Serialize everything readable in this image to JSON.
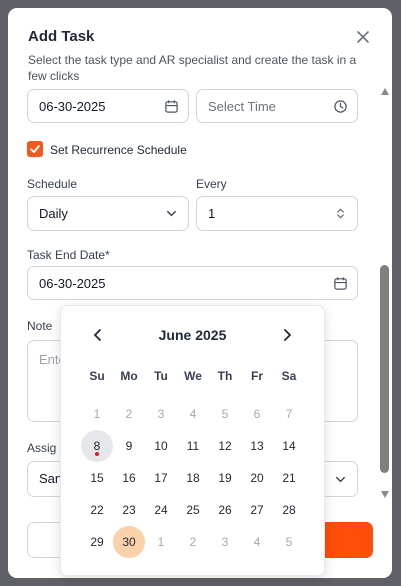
{
  "modal": {
    "title": "Add Task",
    "subtitle": "Select the task type and AR specialist and create the task in a few clicks"
  },
  "date_field": {
    "value": "06-30-2025"
  },
  "time_field": {
    "placeholder": "Select Time"
  },
  "recurrence": {
    "label": "Set Recurrence Schedule",
    "checked": true
  },
  "schedule": {
    "label": "Schedule",
    "value": "Daily"
  },
  "every": {
    "label": "Every",
    "value": "1"
  },
  "end_date": {
    "label": "Task End Date*",
    "value": "06-30-2025"
  },
  "note": {
    "label": "Note",
    "placeholder": "Ente"
  },
  "assign": {
    "label": "Assig",
    "value": "San"
  },
  "calendar": {
    "month_label": "June 2025",
    "weekdays": [
      "Su",
      "Mo",
      "Tu",
      "We",
      "Th",
      "Fr",
      "Sa"
    ],
    "weeks": [
      [
        "1",
        "2",
        "3",
        "4",
        "5",
        "6",
        "7"
      ],
      [
        "8",
        "9",
        "10",
        "11",
        "12",
        "13",
        "14"
      ],
      [
        "15",
        "16",
        "17",
        "18",
        "19",
        "20",
        "21"
      ],
      [
        "22",
        "23",
        "24",
        "25",
        "26",
        "27",
        "28"
      ],
      [
        "29",
        "30",
        "1",
        "2",
        "3",
        "4",
        "5"
      ]
    ],
    "today": "8",
    "selected": "30"
  },
  "colors": {
    "accent": "#ff4d0a",
    "checkbox": "#f05a1a",
    "selected_day": "#fbd1aa",
    "today_day": "#e5e7eb",
    "today_dot": "#e11d1d"
  },
  "icons": {
    "close": "close-icon",
    "calendar": "calendar-icon",
    "clock": "clock-icon",
    "chevron_down": "chevron-down-icon",
    "stepper": "stepper-icon",
    "prev": "chevron-left-icon",
    "next": "chevron-right-icon",
    "check": "check-icon"
  }
}
